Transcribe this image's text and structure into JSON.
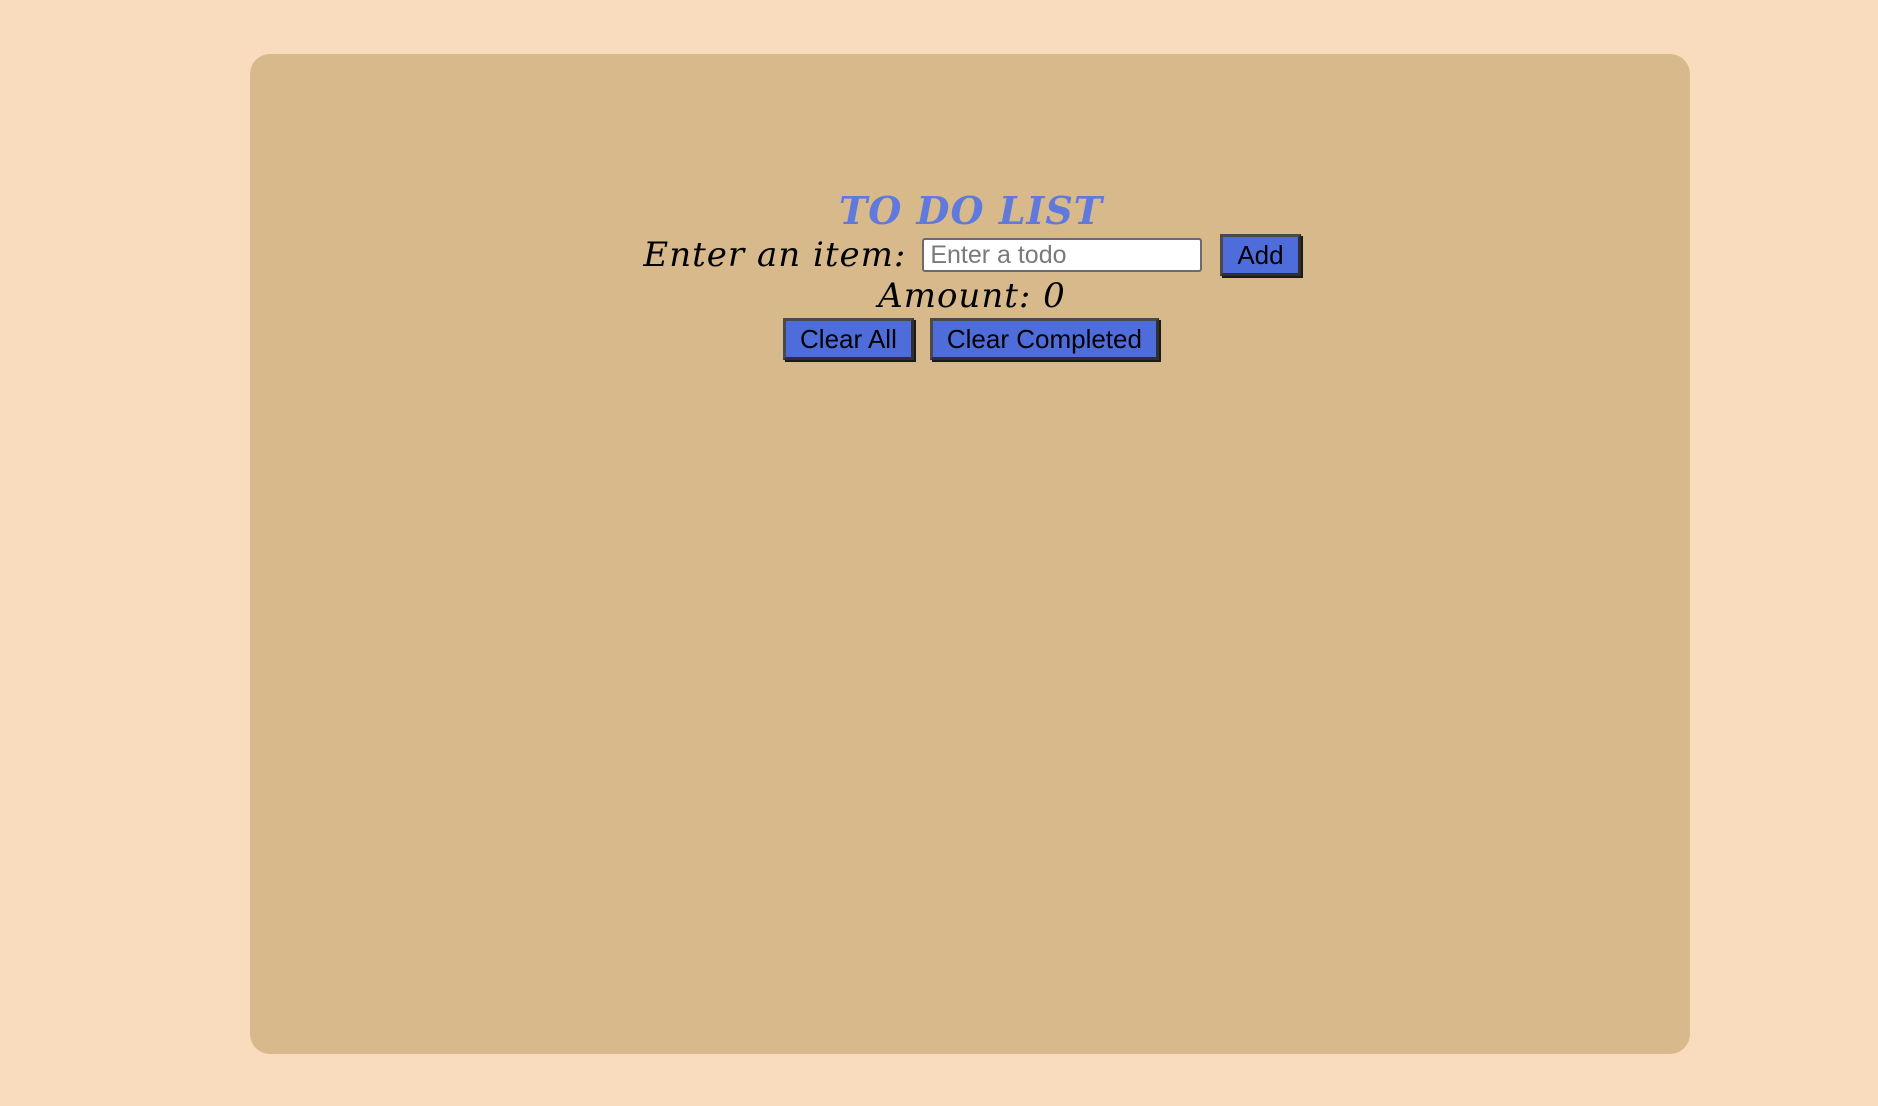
{
  "header": {
    "title": "TO DO LIST"
  },
  "entry": {
    "label": "Enter an item:",
    "input_value": "",
    "input_placeholder": "Enter a todo",
    "add_label": "Add"
  },
  "amount": {
    "label": "Amount:",
    "value": "0"
  },
  "actions": {
    "clear_all_label": "Clear All",
    "clear_completed_label": "Clear Completed"
  },
  "colors": {
    "page_background": "#f9dcbd",
    "card_background": "#d8b98b",
    "title": "#5f79dc",
    "button": "#4e6ddb"
  }
}
